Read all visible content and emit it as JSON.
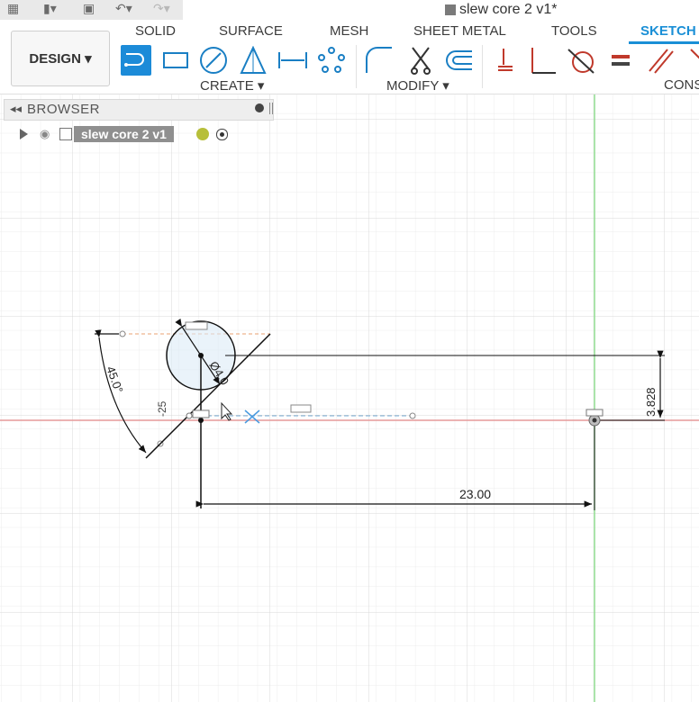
{
  "qat": {
    "grid_icon": "grid-icon",
    "file_icon": "file-icon",
    "save_icon": "save-icon",
    "undo_icon": "undo-icon",
    "redo_icon": "redo-icon"
  },
  "document": {
    "title": "slew core 2 v1*"
  },
  "workspace": {
    "design_label": "DESIGN ▾"
  },
  "tabs": [
    {
      "label": "SOLID",
      "active": false
    },
    {
      "label": "SURFACE",
      "active": false
    },
    {
      "label": "MESH",
      "active": false
    },
    {
      "label": "SHEET METAL",
      "active": false
    },
    {
      "label": "TOOLS",
      "active": false
    },
    {
      "label": "SKETCH",
      "active": true
    }
  ],
  "groups": {
    "create": "CREATE ▾",
    "modify": "MODIFY ▾",
    "constrain": "CONS"
  },
  "browser": {
    "title": "BROWSER",
    "component": "slew core 2 v1"
  },
  "sketch": {
    "dim_angle": "45.0°",
    "dim_diameter": "Ø4.0",
    "dim_small": "-25",
    "dim_vertical": "3.828",
    "dim_horizontal": "23.00"
  },
  "colors": {
    "accent": "#1a8fd6",
    "x_axis": "#e07a7a",
    "y_axis": "#7fd07f",
    "grid": "#e6e6e6"
  }
}
